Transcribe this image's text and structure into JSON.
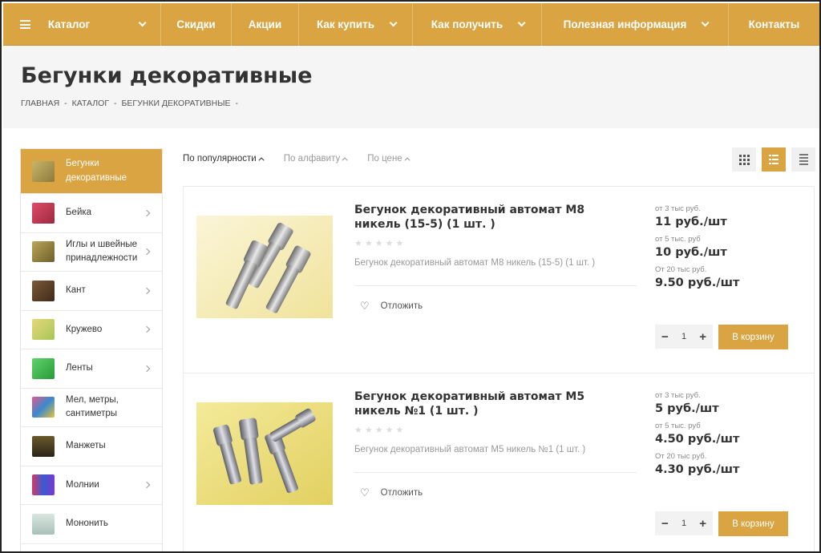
{
  "nav": {
    "items": [
      {
        "label": "Каталог"
      },
      {
        "label": "Скидки"
      },
      {
        "label": "Акции"
      },
      {
        "label": "Как купить"
      },
      {
        "label": "Как получить"
      },
      {
        "label": "Полезная информация"
      },
      {
        "label": "Контакты"
      }
    ]
  },
  "page": {
    "title": "Бегунки декоративные",
    "breadcrumb": [
      "ГЛАВНАЯ",
      "-",
      "КАТАЛОГ",
      "-",
      "БЕГУНКИ ДЕКОРАТИВНЫЕ",
      "-"
    ]
  },
  "sidebar": {
    "items": [
      {
        "label": "Бегунки декоративные",
        "active": true
      },
      {
        "label": "Бейка"
      },
      {
        "label": "Иглы и швейные принадлежности"
      },
      {
        "label": "Кант"
      },
      {
        "label": "Кружево"
      },
      {
        "label": "Ленты"
      },
      {
        "label": "Мел, метры, сантиметры"
      },
      {
        "label": "Манжеты"
      },
      {
        "label": "Молнии"
      },
      {
        "label": "Мононить"
      }
    ]
  },
  "sort": {
    "options": [
      "По популярности",
      "По алфавиту",
      "По цене"
    ],
    "active": "По популярности"
  },
  "products": [
    {
      "name": "Бегунок декоративный автомат М8 никель (15-5) (1 шт. )",
      "desc": "Бегунок декоративный автомат М8 никель (15-5) (1 шт. )",
      "wish_label": "Отложить",
      "tiers": [
        {
          "label": "от 3 тыс руб.",
          "price": "11 руб./шт"
        },
        {
          "label": "от 5 тыс. руб",
          "price": "10 руб./шт"
        },
        {
          "label": "От 20 тыс руб.",
          "price": "9.50 руб./шт"
        }
      ],
      "qty": "1",
      "cart_label": "В корзину"
    },
    {
      "name": "Бегунок декоративный автомат М5 никель №1 (1 шт. )",
      "desc": "Бегунок декоративный автомат М5 никель №1 (1 шт. )",
      "wish_label": "Отложить",
      "tiers": [
        {
          "label": "от 3 тыс руб.",
          "price": "5 руб./шт"
        },
        {
          "label": "от 5 тыс. руб",
          "price": "4.50 руб./шт"
        },
        {
          "label": "От 20 тыс руб.",
          "price": "4.30 руб./шт"
        }
      ],
      "qty": "1",
      "cart_label": "В корзину"
    }
  ],
  "colors": {
    "accent": "#d9a441"
  }
}
